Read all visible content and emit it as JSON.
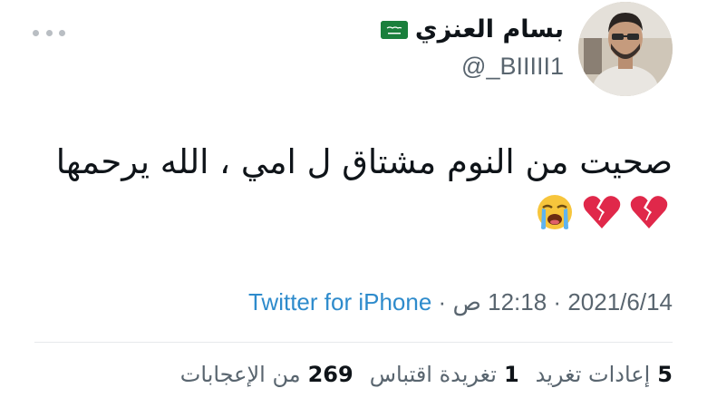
{
  "author": {
    "display_name": "بسام العنزي",
    "flag": "saudi-flag-icon",
    "handle": "@_BIIIII1"
  },
  "tweet": {
    "text": "صحيت من النوم مشتاق ل امي ، الله يرحمها",
    "emojis": [
      "broken-heart-icon",
      "broken-heart-icon",
      "loudly-crying-face-icon"
    ]
  },
  "meta": {
    "date": "2021/6/14",
    "separator1": "·",
    "time": "12:18 ص",
    "separator2": "·",
    "source": "Twitter for iPhone"
  },
  "stats": {
    "retweets_count": "5",
    "retweets_label": "إعادات تغريد",
    "quotes_count": "1",
    "quotes_label": "تغريدة اقتباس",
    "likes_count": "269",
    "likes_label": "من الإعجابات"
  },
  "colors": {
    "text_primary": "#0f1419",
    "text_secondary": "#59656f",
    "link": "#2e8bcc",
    "divider": "#e6e9ec"
  }
}
